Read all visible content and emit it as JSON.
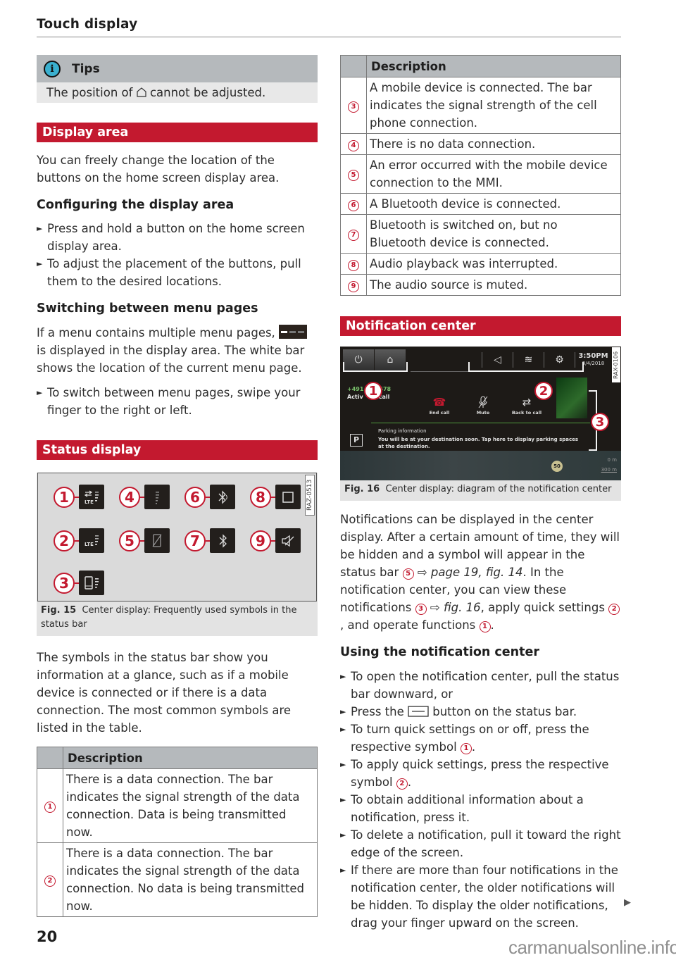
{
  "header": {
    "title": "Touch display"
  },
  "tips": {
    "icon": "info-icon",
    "title": "Tips",
    "text_before": "The position of",
    "text_icon": "home-icon",
    "text_after": "cannot be adjusted."
  },
  "display_area": {
    "section_title": "Display area",
    "intro": "You can freely change the location of the buttons on the home screen display area.",
    "configuring": {
      "heading": "Configuring the display area",
      "steps": [
        "Press and hold a button on the home screen display area.",
        "To adjust the placement of the buttons, pull them to the desired locations."
      ]
    },
    "switching": {
      "heading": "Switching between menu pages",
      "text_before": "If a menu contains multiple menu pages,",
      "text_icon": "page-indicator-icon",
      "text_after": "is displayed in the display area. The white bar shows the location of the current menu page.",
      "steps": [
        "To switch between menu pages, swipe your finger to the right or left."
      ]
    }
  },
  "status_display": {
    "section_title": "Status display",
    "figure": {
      "tag": "RAZ-0513",
      "caption_label": "Fig. 15",
      "caption_text": "Center display: Frequently used symbols in the status bar",
      "symbols": [
        {
          "num": "1",
          "icon": "lte-data-transfer-icon",
          "glyph": "⇄"
        },
        {
          "num": "2",
          "icon": "lte-signal-icon",
          "glyph": "LTE"
        },
        {
          "num": "3",
          "icon": "mobile-device-signal-icon",
          "glyph": "▯"
        },
        {
          "num": "4",
          "icon": "no-data-signal-icon",
          "glyph": "⋮"
        },
        {
          "num": "5",
          "icon": "mobile-device-error-icon",
          "glyph": "⍁"
        },
        {
          "num": "6",
          "icon": "bluetooth-connected-icon",
          "glyph": "✱"
        },
        {
          "num": "7",
          "icon": "bluetooth-on-icon",
          "glyph": "ᛒ"
        },
        {
          "num": "8",
          "icon": "audio-stop-icon",
          "glyph": "□"
        },
        {
          "num": "9",
          "icon": "mute-icon",
          "glyph": "🔇"
        }
      ]
    },
    "paragraph": "The symbols in the status bar show you information at a glance, such as if a mobile device is connected or if there is a data connection. The most common symbols are listed in the table.",
    "table_header": "Description",
    "table_rows": [
      {
        "num": "1",
        "text": "There is a data connection. The bar indicates the signal strength of the data connection. Data is being transmitted now."
      },
      {
        "num": "2",
        "text": "There is a data connection. The bar indicates the signal strength of the data connection. No data is being transmitted now."
      },
      {
        "num": "3",
        "text": "A mobile device is connected. The bar indicates the signal strength of the cell phone connection."
      },
      {
        "num": "4",
        "text": "There is no data connection."
      },
      {
        "num": "5",
        "text": "An error occurred with the mobile device connection to the MMI."
      },
      {
        "num": "6",
        "text": "A Bluetooth device is connected."
      },
      {
        "num": "7",
        "text": "Bluetooth is switched on, but no Bluetooth device is connected."
      },
      {
        "num": "8",
        "text": "Audio playback was interrupted."
      },
      {
        "num": "9",
        "text": "The audio source is muted."
      }
    ]
  },
  "notification_center": {
    "section_title": "Notification center",
    "figure": {
      "tag": "RAX-0106",
      "caption_label": "Fig. 16",
      "caption_text": "Center display: diagram of the notification center",
      "screen": {
        "quick_buttons": [
          {
            "icon": "power-display-icon",
            "glyph": "⏻"
          },
          {
            "icon": "home-icon",
            "glyph": "⌂"
          }
        ],
        "status_icons": [
          {
            "icon": "speaker-icon",
            "glyph": "◁"
          },
          {
            "icon": "wifi-icon",
            "glyph": "≋"
          },
          {
            "icon": "settings-icon",
            "glyph": "⚙"
          }
        ],
        "time": "3:50PM",
        "date": "9/4/2018",
        "phone_number": "+491",
        "phone_number_end": "678",
        "call_state_start": "Activ",
        "call_state_end": "call",
        "actions": [
          {
            "icon": "end-call-icon",
            "glyph": "☎",
            "label": "End call"
          },
          {
            "icon": "mute-microphone-icon",
            "glyph": "🎙",
            "label": "Mute"
          },
          {
            "icon": "back-to-call-icon",
            "glyph": "⇄",
            "label": "Back to call"
          }
        ],
        "notification_icon": "P",
        "notification_title": "Parking information",
        "notification_text": "You will be at your destination soon. Tap here to display parking spaces at the destination.",
        "speed_limit": "50",
        "scale_top": "0 m",
        "scale_bottom": "300 m",
        "callouts": [
          "1",
          "2",
          "3"
        ]
      }
    },
    "paragraph_parts": {
      "p1": "Notifications can be displayed in the center display. After a certain amount of time, they will be hidden and a symbol will appear in the status bar",
      "c1": "5",
      "x1": "⇨ page 19, fig. 14",
      "p2": ". In the notification center, you can view these notifications",
      "c2": "3",
      "x2": "⇨ fig. 16",
      "p3": ", apply quick settings",
      "c3": "2",
      "p4": ", and operate functions",
      "c4": "1",
      "p5": "."
    },
    "using": {
      "heading": "Using the notification center",
      "steps": [
        {
          "text": "To open the notification center, pull the status bar downward, or"
        },
        {
          "text_before": "Press the",
          "icon": "menu-button-icon",
          "text_after": "button on the status bar."
        },
        {
          "text_before": "To turn quick settings on or off, press the respective symbol",
          "callout": "1",
          "text_after": "."
        },
        {
          "text_before": "To apply quick settings, press the respective symbol",
          "callout": "2",
          "text_after": "."
        },
        {
          "text": "To obtain additional information about a notification, press it."
        },
        {
          "text": "To delete a notification, pull it toward the right edge of the screen."
        },
        {
          "text": "If there are more than four notifications in the notification center, the older notifications will be hidden. To display the older notifications, drag your finger upward on the screen."
        }
      ]
    }
  },
  "footer": {
    "page_number": "20",
    "continue_icon": "continue-arrow-icon",
    "watermark": "carmanualsonline.info"
  },
  "colors": {
    "accent_red": "#c3192f",
    "table_header_gray": "#b5b9bc",
    "figure_bg": "#e3e3e3"
  }
}
